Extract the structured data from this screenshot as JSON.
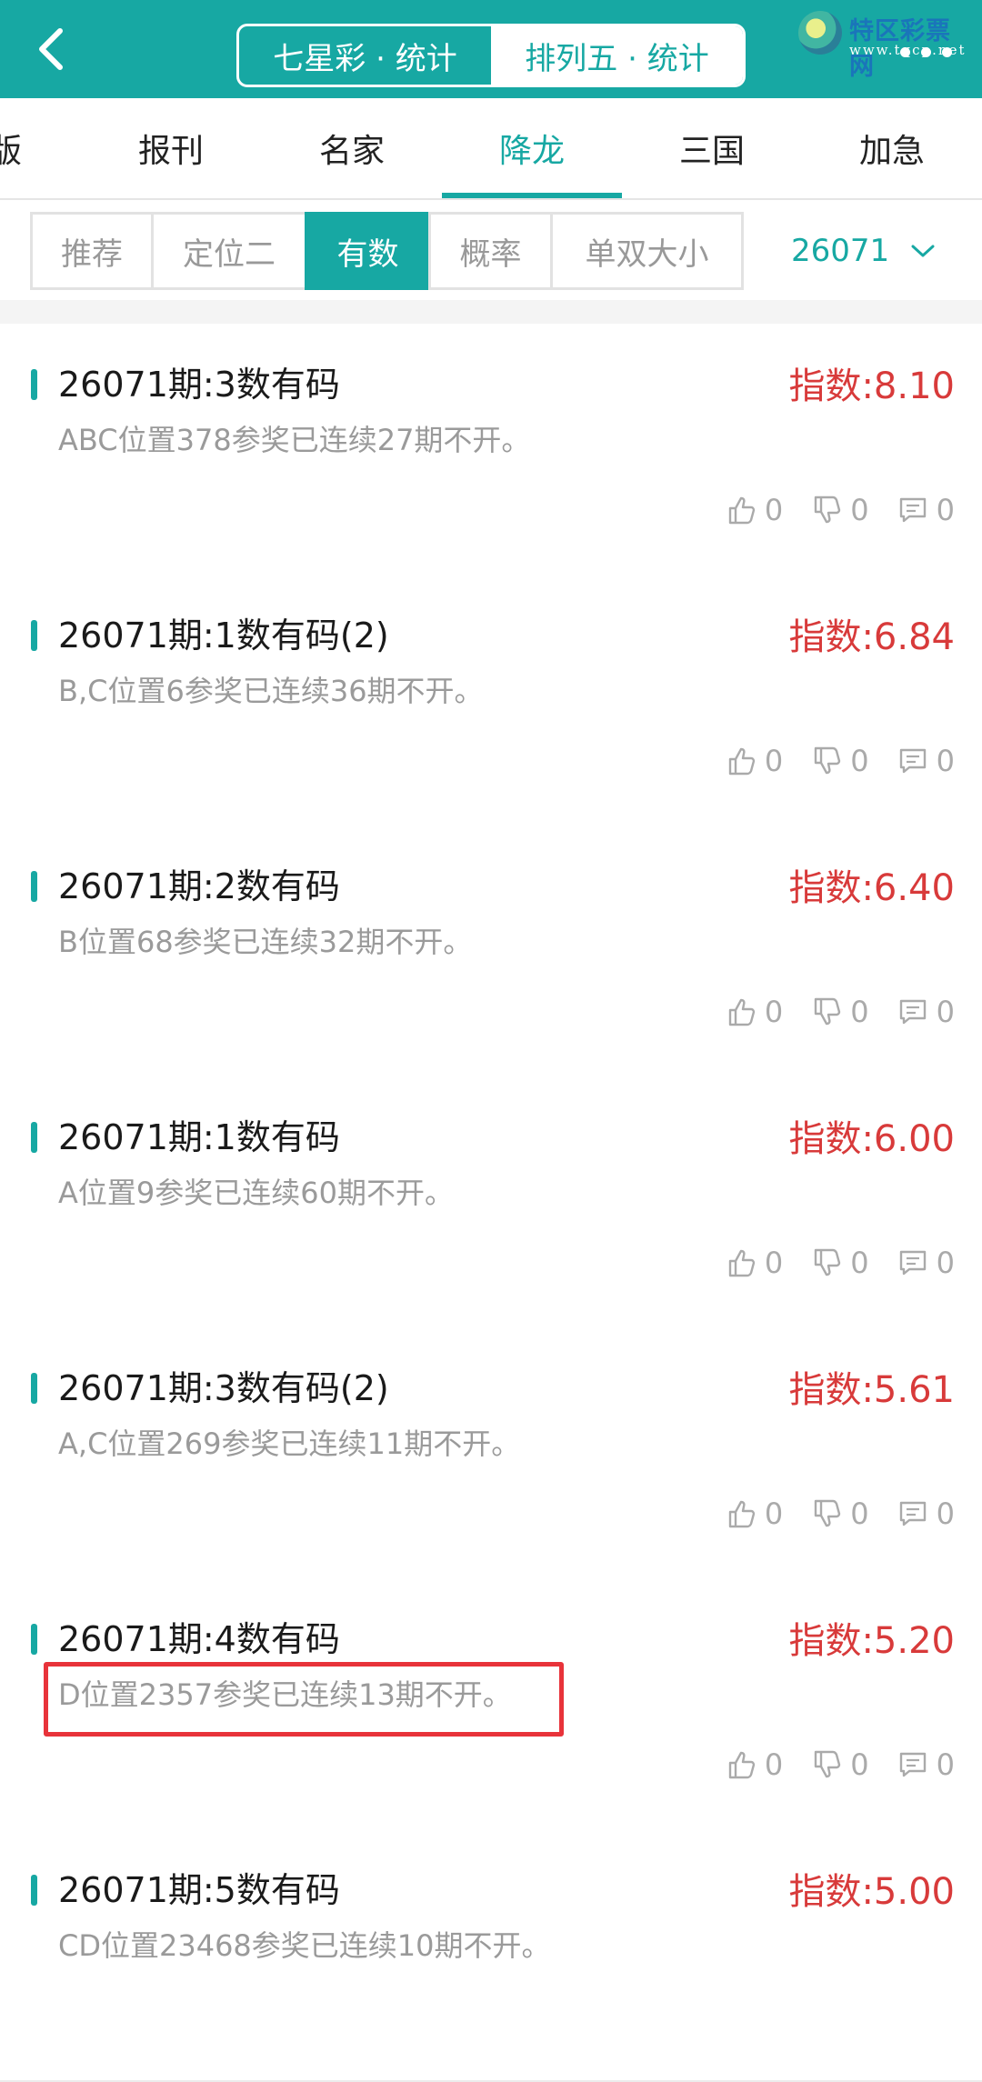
{
  "header": {
    "segments": [
      "七星彩 · 统计",
      "排列五 · 统计"
    ],
    "active_segment": 1,
    "watermark_brand": "特区彩票网",
    "watermark_url": "www.tqcp.net"
  },
  "nav_tabs": [
    "版",
    "报刊",
    "名家",
    "降龙",
    "三国",
    "加急"
  ],
  "active_nav_tab": "降龙",
  "filters": [
    "推荐",
    "定位二",
    "有数",
    "概率",
    "单双大小"
  ],
  "active_filter": "有数",
  "period_select": "26071",
  "colors": {
    "accent": "#17a8a3",
    "index_red": "#d83a3a",
    "highlight": "#e8333a"
  },
  "items": [
    {
      "title": "26071期:3数有码",
      "index": "指数:8.10",
      "desc": "ABC位置378参奖已连续27期不开。",
      "likes": "0",
      "dislikes": "0",
      "comments": "0"
    },
    {
      "title": "26071期:1数有码(2)",
      "index": "指数:6.84",
      "desc": "B,C位置6参奖已连续36期不开。",
      "likes": "0",
      "dislikes": "0",
      "comments": "0"
    },
    {
      "title": "26071期:2数有码",
      "index": "指数:6.40",
      "desc": "B位置68参奖已连续32期不开。",
      "likes": "0",
      "dislikes": "0",
      "comments": "0"
    },
    {
      "title": "26071期:1数有码",
      "index": "指数:6.00",
      "desc": "A位置9参奖已连续60期不开。",
      "likes": "0",
      "dislikes": "0",
      "comments": "0"
    },
    {
      "title": "26071期:3数有码(2)",
      "index": "指数:5.61",
      "desc": "A,C位置269参奖已连续11期不开。",
      "likes": "0",
      "dislikes": "0",
      "comments": "0"
    },
    {
      "title": "26071期:4数有码",
      "index": "指数:5.20",
      "desc": "D位置2357参奖已连续13期不开。",
      "likes": "0",
      "dislikes": "0",
      "comments": "0",
      "highlighted": true
    },
    {
      "title": "26071期:5数有码",
      "index": "指数:5.00",
      "desc": "CD位置23468参奖已连续10期不开。"
    }
  ]
}
